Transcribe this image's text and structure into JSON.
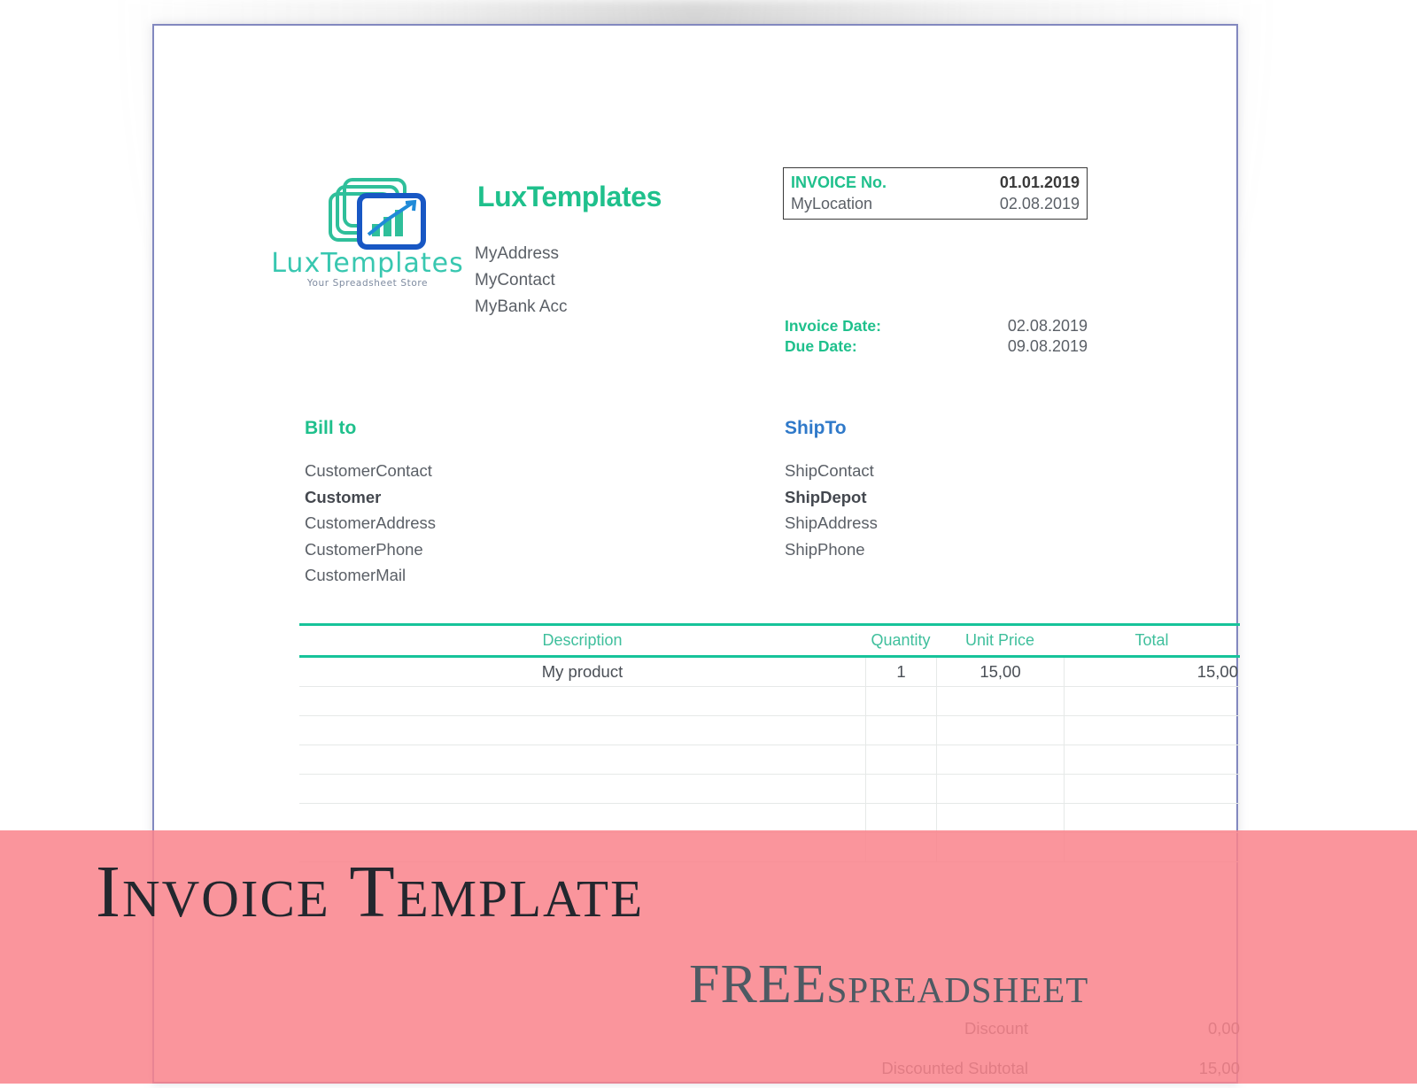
{
  "document": {
    "logo": {
      "wordmark": "LuxTemplates",
      "tagline": "Your Spreadsheet Store"
    },
    "brand": {
      "name": "LuxTemplates",
      "lines": [
        "MyAddress",
        "MyContact",
        "MyBank Acc"
      ]
    },
    "invoice_box": {
      "number_label": "INVOICE No.",
      "number_value": "01.01.2019",
      "location_label": "MyLocation",
      "location_value": "02.08.2019"
    },
    "dates": [
      {
        "label": "Invoice Date:",
        "value": "02.08.2019"
      },
      {
        "label": "Due Date:",
        "value": "09.08.2019"
      }
    ],
    "bill_to": {
      "title": "Bill to",
      "contact": "CustomerContact",
      "name": "Customer",
      "address": "CustomerAddress",
      "phone": "CustomerPhone",
      "mail": "CustomerMail"
    },
    "ship_to": {
      "title": "ShipTo",
      "contact": "ShipContact",
      "name": "ShipDepot",
      "address": "ShipAddress",
      "phone": "ShipPhone"
    },
    "table": {
      "headers": {
        "description": "Description",
        "quantity": "Quantity",
        "unit_price": "Unit Price",
        "total": "Total"
      },
      "rows": [
        {
          "description": "My product",
          "quantity": "1",
          "unit_price": "15,00",
          "total": "15,00"
        },
        {
          "description": "",
          "quantity": "",
          "unit_price": "",
          "total": ""
        },
        {
          "description": "",
          "quantity": "",
          "unit_price": "",
          "total": ""
        },
        {
          "description": "",
          "quantity": "",
          "unit_price": "",
          "total": ""
        },
        {
          "description": "",
          "quantity": "",
          "unit_price": "",
          "total": ""
        },
        {
          "description": "",
          "quantity": "",
          "unit_price": "",
          "total": ""
        },
        {
          "description": "",
          "quantity": "",
          "unit_price": "",
          "total": ""
        }
      ]
    },
    "totals": [
      {
        "label": "Discount",
        "value": "0,00"
      },
      {
        "label": "Discounted Subtotal",
        "value": "15,00"
      }
    ]
  },
  "banner": {
    "title": "Invoice Template",
    "sub_big": "FREE",
    "sub_small": "spreadsheet"
  },
  "colors": {
    "brand_green": "#1fc08c",
    "logo_teal": "#38c7b0",
    "ship_blue": "#2f79c9",
    "table_rule": "#17c39a",
    "banner_pink": "#f9848c",
    "banner_ink": "#23272e",
    "page_border": "#8288bf"
  }
}
